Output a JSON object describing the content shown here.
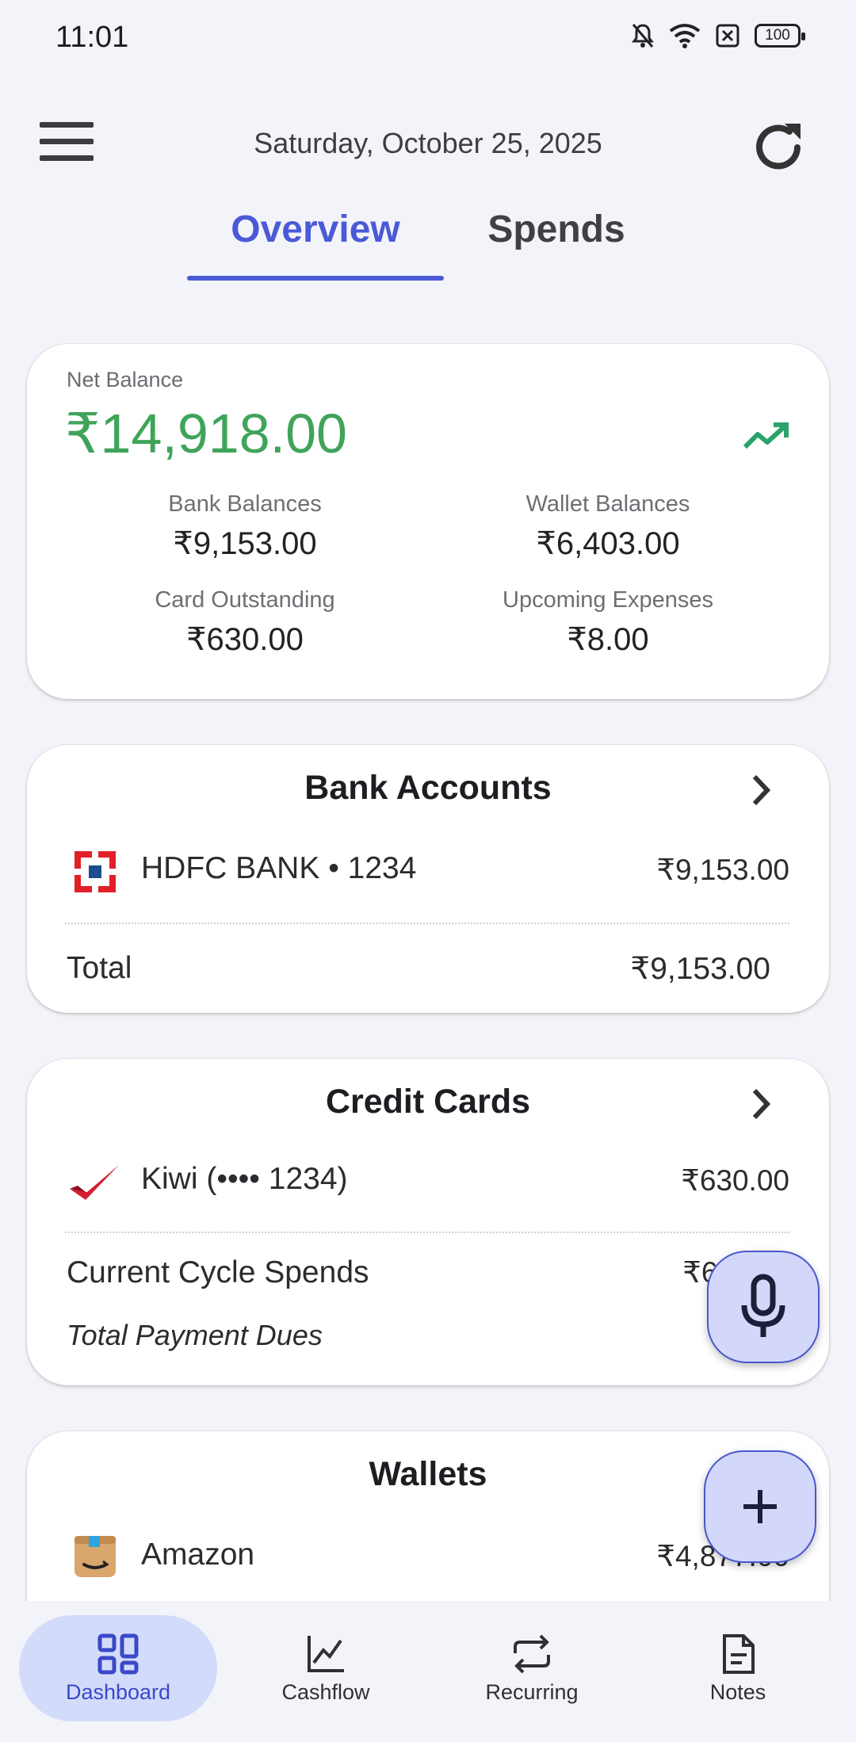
{
  "status_bar": {
    "time": "11:01",
    "battery": "100"
  },
  "header": {
    "date": "Saturday, October 25, 2025"
  },
  "tabs": [
    {
      "label": "Overview",
      "active": true
    },
    {
      "label": "Spends",
      "active": false
    }
  ],
  "net_balance": {
    "label": "Net Balance",
    "value": "₹14,918.00",
    "value_color": "#3fa45a",
    "stats": [
      {
        "label": "Bank Balances",
        "value": "₹9,153.00"
      },
      {
        "label": "Wallet Balances",
        "value": "₹6,403.00"
      },
      {
        "label": "Card Outstanding",
        "value": "₹630.00"
      },
      {
        "label": "Upcoming Expenses",
        "value": "₹8.00"
      }
    ]
  },
  "bank_accounts": {
    "title": "Bank Accounts",
    "items": [
      {
        "name": "HDFC BANK • 1234",
        "amount": "₹9,153.00",
        "icon": "hdfc-logo-icon"
      }
    ],
    "total_label": "Total",
    "total_value": "₹9,153.00"
  },
  "credit_cards": {
    "title": "Credit Cards",
    "items": [
      {
        "name": "Kiwi (•••• 1234)",
        "amount": "₹630.00",
        "icon": "kiwi-logo-icon"
      }
    ],
    "cycle_label": "Current Cycle Spends",
    "cycle_value": "₹63",
    "dues_label": "Total Payment Dues"
  },
  "wallets": {
    "title": "Wallets",
    "items": [
      {
        "name": "Amazon",
        "amount": "₹4,877.00",
        "icon": "amazon-logo-icon"
      }
    ]
  },
  "bottom_nav": [
    {
      "label": "Dashboard",
      "icon": "dashboard-icon",
      "active": true
    },
    {
      "label": "Cashflow",
      "icon": "chart-icon",
      "active": false
    },
    {
      "label": "Recurring",
      "icon": "repeat-icon",
      "active": false
    },
    {
      "label": "Notes",
      "icon": "notes-icon",
      "active": false
    }
  ],
  "colors": {
    "accent": "#4a5ad6",
    "positive": "#3fa45a",
    "background": "#f3f4f9",
    "fab": "#d3d8fb"
  }
}
